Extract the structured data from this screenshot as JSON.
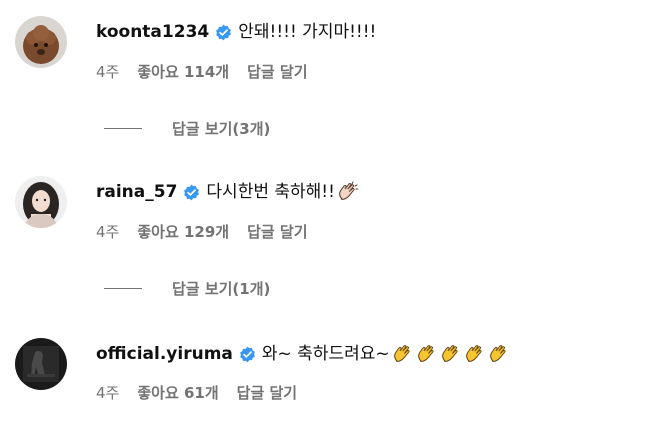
{
  "comments": [
    {
      "username": "koonta1234",
      "text": "안돼!!!! 가지마!!!!",
      "time": "4주",
      "likes": "좋아요 114개",
      "reply_label": "답글 달기",
      "view_replies": "답글 보기(3개)",
      "emoji": []
    },
    {
      "username": "raina_57",
      "text": "다시한번 축하해!!",
      "time": "4주",
      "likes": "좋아요 129개",
      "reply_label": "답글 달기",
      "view_replies": "답글 보기(1개)",
      "emoji": [
        "clapping-hands"
      ]
    },
    {
      "username": "official.yiruma",
      "text": "와~ 축하드려요~",
      "time": "4주",
      "likes": "좋아요 61개",
      "reply_label": "답글 달기",
      "emoji": [
        "clapping-hands",
        "clapping-hands",
        "clapping-hands",
        "clapping-hands",
        "clapping-hands"
      ]
    }
  ],
  "colors": {
    "verified": "#3897f0",
    "meta_text": "#737373",
    "clap_yellow": "#f7c531",
    "clap_skin": "#f2d4c4"
  }
}
